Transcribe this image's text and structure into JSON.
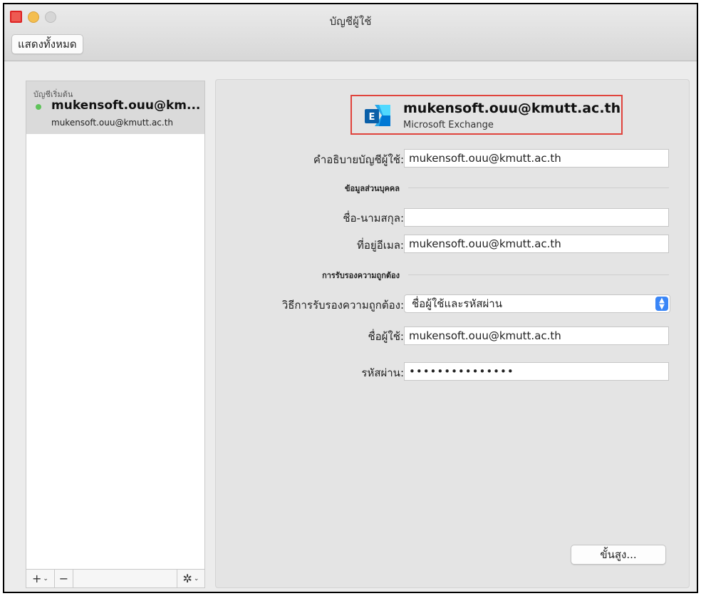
{
  "window": {
    "title": "บัญชีผู้ใช้",
    "show_all_label": "แสดงทั้งหมด"
  },
  "sidebar": {
    "section_label": "บัญชีเริ่มต้น",
    "accounts": [
      {
        "name": "mukensoft.ouu@km...",
        "email": "mukensoft.ouu@kmutt.ac.th",
        "status_color": "#5fc35a"
      }
    ],
    "toolbar": {
      "add_glyph": "+",
      "remove_glyph": "−",
      "gear_glyph": "✲",
      "chevron_glyph": "⌄"
    }
  },
  "account_header": {
    "email": "mukensoft.ouu@kmutt.ac.th",
    "type": "Microsoft Exchange",
    "icon": "microsoft-exchange-icon",
    "highlight_color": "#e0433c"
  },
  "form": {
    "description_label": "คำอธิบายบัญชีผู้ใช้:",
    "description_value": "mukensoft.ouu@kmutt.ac.th",
    "personal_section": "ข้อมูลส่วนบุคคล",
    "fullname_label": "ชื่อ-นามสกุล:",
    "fullname_value": "",
    "email_label": "ที่อยู่อีเมล:",
    "email_value": "mukensoft.ouu@kmutt.ac.th",
    "auth_section": "การรับรองความถูกต้อง",
    "auth_method_label": "วิธีการรับรองความถูกต้อง:",
    "auth_method_value": "ชื่อผู้ใช้และรหัสผ่าน",
    "username_label": "ชื่อผู้ใช้:",
    "username_value": "mukensoft.ouu@kmutt.ac.th",
    "password_label": "รหัสผ่าน:",
    "password_value": "•••••••••••••••",
    "advanced_button": "ขั้นสูง..."
  }
}
